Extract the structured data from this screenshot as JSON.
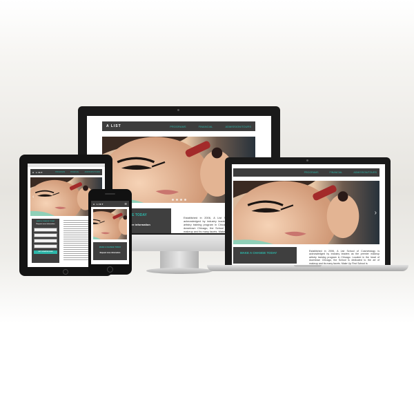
{
  "site": {
    "logo": "A LIST",
    "nav": [
      "PROGRAMS",
      "FINANCIAL",
      "ADMISSION/TOURS"
    ]
  },
  "promo": {
    "headline": "A CHANGE TODAY",
    "headline_tablet": "MAKE A CHANGE TODAY",
    "headline_laptop": "MAKE A CHANGE TODAY",
    "sub": "Request more information"
  },
  "intro_text": "Established in 2006, A List School of Cosmetology is acknowledged by industry leaders as the premier makeup artistry training program in Chicago. Located in the heart of downtown Chicago, the School is dedicated to the art of makeup and its many facets. Make Up First School is",
  "tablet": {
    "form_title": "Request more information",
    "submit_label": "GET STARTED NOW"
  },
  "icons": {
    "prev": "chevron-left-icon",
    "next": "chevron-right-icon"
  },
  "colors": {
    "accent": "#2cb5a8",
    "nav_bg": "#3d3d3d",
    "device_frame": "#1a1a1a"
  }
}
